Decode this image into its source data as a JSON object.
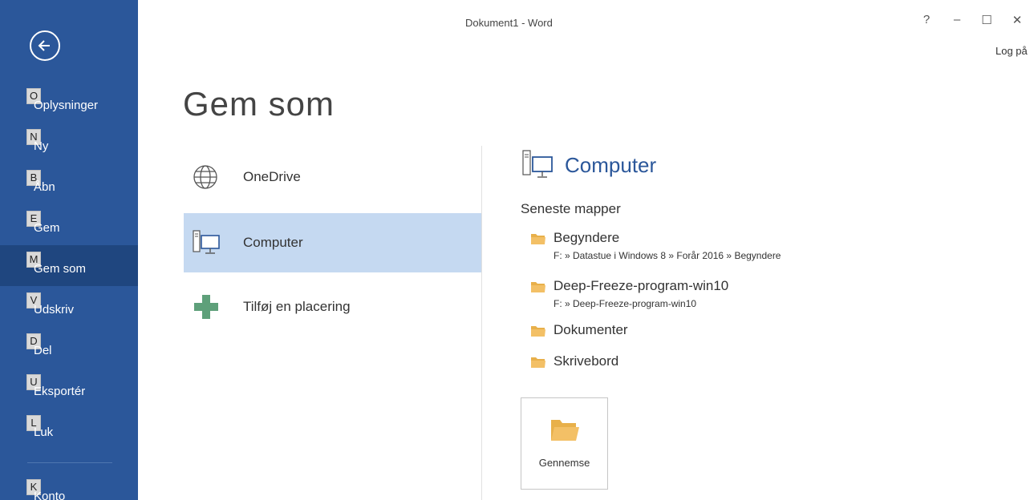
{
  "titlebar": {
    "title": "Dokument1 - Word",
    "help": "?",
    "minimize": "–",
    "maximize": "☐",
    "close": "✕",
    "signin": "Log på"
  },
  "sidebar": {
    "items": [
      {
        "key": "O",
        "label": "Oplysninger"
      },
      {
        "key": "N",
        "label": "Ny"
      },
      {
        "key": "B",
        "label": "Åbn"
      },
      {
        "key": "E",
        "label": "Gem"
      },
      {
        "key": "M",
        "label": "Gem som"
      },
      {
        "key": "V",
        "label": "Udskriv"
      },
      {
        "key": "D",
        "label": "Del"
      },
      {
        "key": "U",
        "label": "Eksportér"
      },
      {
        "key": "L",
        "label": "Luk"
      },
      {
        "key": "K",
        "label": "Konto"
      }
    ]
  },
  "main": {
    "title": "Gem som",
    "places": [
      {
        "label": "OneDrive",
        "icon": "globe-icon"
      },
      {
        "label": "Computer",
        "icon": "computer-icon"
      },
      {
        "label": "Tilføj en placering",
        "icon": "plus-icon"
      }
    ]
  },
  "detail": {
    "title": "Computer",
    "recent_heading": "Seneste mapper",
    "folders": [
      {
        "name": "Begyndere",
        "path": "F: » Datastue i Windows 8 » Forår 2016 » Begyndere"
      },
      {
        "name": "Deep-Freeze-program-win10",
        "path": "F: » Deep-Freeze-program-win10"
      },
      {
        "name": "Dokumenter",
        "path": ""
      },
      {
        "name": "Skrivebord",
        "path": ""
      }
    ],
    "browse_label": "Gennemse"
  },
  "colors": {
    "sidebar": "#2b579a",
    "sidebar_active": "#1f467f",
    "selected_place": "#c5d9f1",
    "accent": "#2b579a",
    "folder": "#f3c066",
    "plus": "#5ea07a"
  }
}
